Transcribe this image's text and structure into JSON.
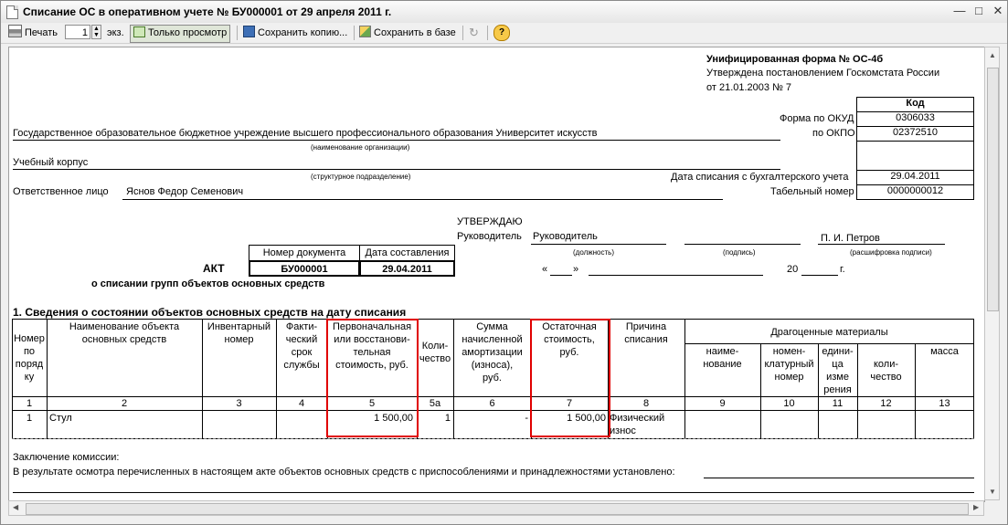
{
  "window": {
    "title": "Списание ОС в оперативном учете № БУ000001 от 29 апреля 2011 г."
  },
  "toolbar": {
    "print_label": "Печать",
    "copies_value": "1",
    "copies_unit": "экз.",
    "view_only_label": "Только просмотр",
    "save_copy_label": "Сохранить копию...",
    "save_db_label": "Сохранить в базе",
    "help_label": "?"
  },
  "form": {
    "unified_form": "Унифицированная форма № ОС-4б",
    "approved_line1": "Утверждена постановлением Госкомстата России",
    "approved_line2": "от 21.01.2003 № 7",
    "code_header": "Код",
    "okud_label": "Форма по ОКУД",
    "okud_value": "0306033",
    "okpo_label": "по ОКПО",
    "okpo_value": "02372510",
    "organization": "Государственное образовательное бюджетное учреждение высшего профессионального образования  Университет искусств",
    "organization_caption": "(наименование организации)",
    "subdivision": "Учебный корпус",
    "subdivision_caption": "(структурное подразделение)",
    "writeoff_date_label": "Дата списания с бухгалтерского учета",
    "writeoff_date_value": "29.04.2011",
    "tab_number_label": "Табельный номер",
    "tab_number_value": "0000000012",
    "responsible_label": "Ответственное лицо",
    "responsible_name": "Яснов Федор Семенович",
    "approve_word": "УТВЕРЖДАЮ",
    "head_label": "Руководитель",
    "head_position": "Руководитель",
    "head_name": "П. И. Петров",
    "position_caption": "(должность)",
    "signature_caption": "(подпись)",
    "decoding_caption": "(расшифровка подписи)",
    "doc_number_header": "Номер документа",
    "doc_date_header": "Дата составления",
    "doc_number_value": "БУ000001",
    "doc_date_value": "29.04.2011",
    "act_title": "АКТ",
    "act_subtitle": "о списании групп объектов основных средств",
    "date_quote_open": "«",
    "date_quote_close": "»",
    "year_prefix": "20",
    "year_suffix": "г.",
    "section_title": "1. Сведения о состоянии объектов основных средств на дату списания",
    "conclusion_label": "Заключение комиссии:",
    "conclusion_text": "В результате осмотра перечисленных в настоящем акте объектов основных средств с приспособлениями и принадлежностями установлено:"
  },
  "table": {
    "headers": [
      "Номер\nпо\nпоряд\nку",
      "Наименование объекта\nосновных средств",
      "Инвентарный\nномер",
      "Факти-\nческий\nсрок\nслужбы",
      "Первоначальная\nили восстанови-\nтельная\nстоимость, руб.",
      "Коли-\nчество",
      "Сумма\nначисленной\nамортизации\n(износа),\nруб.",
      "Остаточная\nстоимость,\nруб.",
      "Причина\nсписания",
      "наиме-\nнование",
      "номен-\nклатурный\nномер",
      "едини-\nца\nизме\nрения",
      "коли-\nчество",
      "масса"
    ],
    "precious_header": "Драгоценные материалы",
    "col_numbers": [
      "1",
      "2",
      "3",
      "4",
      "5",
      "5а",
      "6",
      "7",
      "8",
      "9",
      "10",
      "11",
      "12",
      "13"
    ],
    "row": [
      "1",
      "Стул",
      "",
      "",
      "1 500,00",
      "1",
      "-",
      "1 500,00",
      "Физический\nизнос",
      "",
      "",
      "",
      "",
      ""
    ]
  },
  "colors": {
    "highlight": "#e00000",
    "window_bg": "#f0f0f0",
    "paper": "#ffffff"
  }
}
